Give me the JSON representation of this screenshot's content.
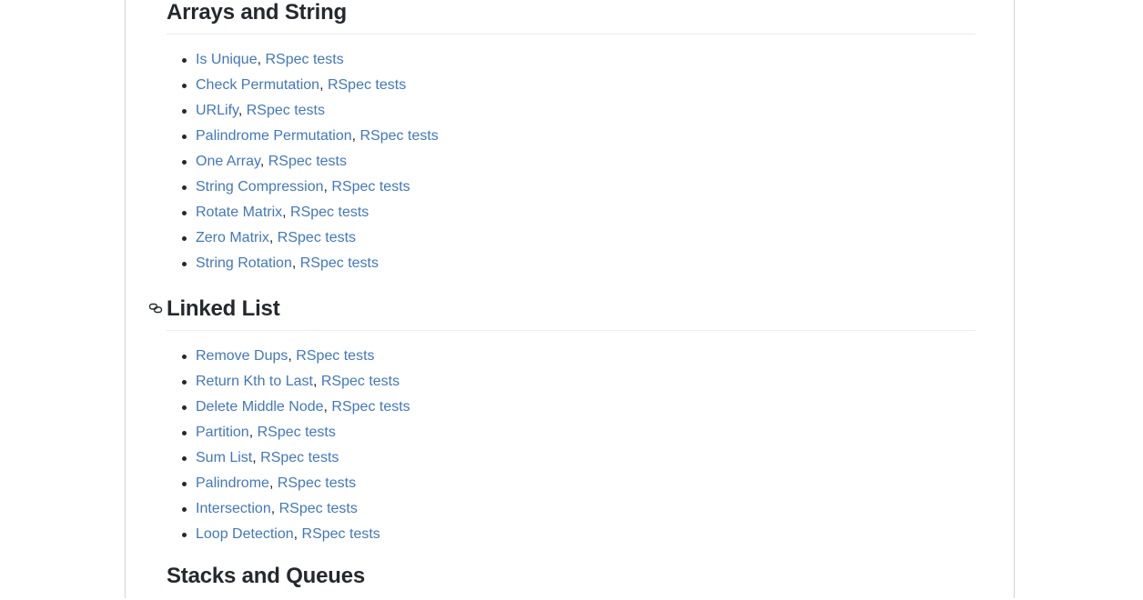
{
  "sections": [
    {
      "title": "Arrays and String",
      "items": [
        {
          "name": "Is Unique",
          "tests": "RSpec tests"
        },
        {
          "name": "Check Permutation",
          "tests": "RSpec tests"
        },
        {
          "name": "URLify",
          "tests": "RSpec tests"
        },
        {
          "name": "Palindrome Permutation",
          "tests": "RSpec tests"
        },
        {
          "name": "One Array",
          "tests": "RSpec tests"
        },
        {
          "name": "String Compression",
          "tests": "RSpec tests"
        },
        {
          "name": "Rotate Matrix",
          "tests": "RSpec tests"
        },
        {
          "name": "Zero Matrix",
          "tests": "RSpec tests"
        },
        {
          "name": "String Rotation",
          "tests": "RSpec tests"
        }
      ]
    },
    {
      "title": "Linked List",
      "items": [
        {
          "name": "Remove Dups",
          "tests": "RSpec tests"
        },
        {
          "name": "Return Kth to Last",
          "tests": "RSpec tests"
        },
        {
          "name": "Delete Middle Node",
          "tests": "RSpec tests"
        },
        {
          "name": "Partition",
          "tests": "RSpec tests"
        },
        {
          "name": "Sum List",
          "tests": "RSpec tests"
        },
        {
          "name": "Palindrome",
          "tests": "RSpec tests"
        },
        {
          "name": "Intersection",
          "tests": "RSpec tests"
        },
        {
          "name": "Loop Detection",
          "tests": "RSpec tests"
        }
      ]
    },
    {
      "title": "Stacks and Queues",
      "items": []
    }
  ],
  "separator": ", ",
  "anchor_icon": "link-icon",
  "colors": {
    "link": "#4078c0",
    "text": "#24292e",
    "rule": "#eaecef",
    "border": "#d1d5da"
  }
}
